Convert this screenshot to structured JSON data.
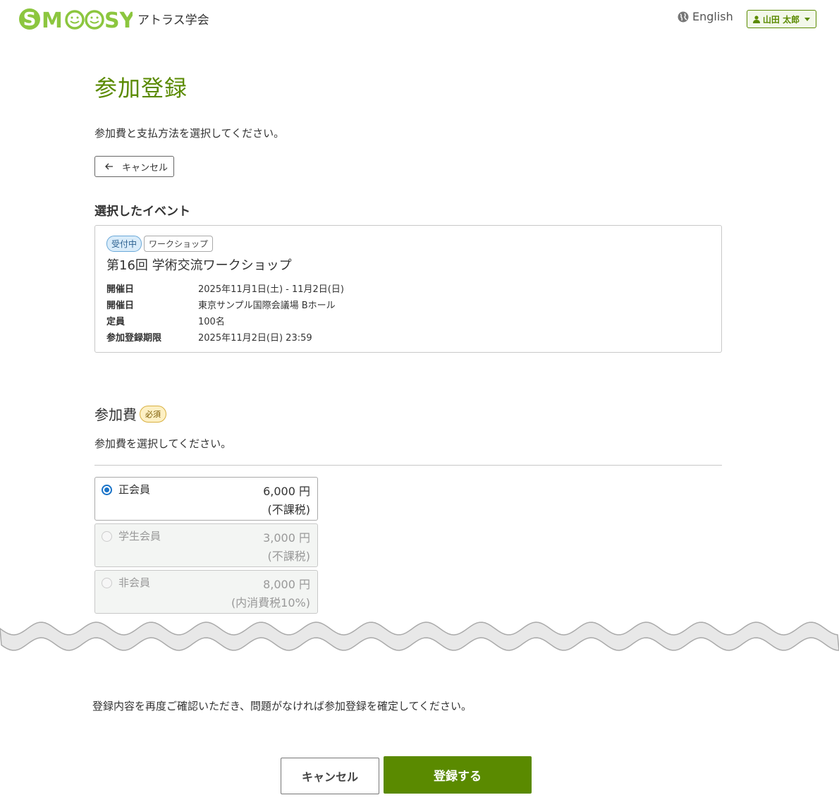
{
  "header": {
    "logo_text": "SMOOSY",
    "org_name": "アトラス学会",
    "language_link": "English",
    "user_name": "山田 太郎"
  },
  "page": {
    "title": "参加登録",
    "intro": "参加費と支払方法を選択してください。",
    "back_button": "キャンセル"
  },
  "event_section": {
    "heading": "選択したイベント",
    "status_badge": "受付中",
    "type_badge": "ワークショップ",
    "name": "第16回 学術交流ワークショップ",
    "details": [
      {
        "label": "開催日",
        "value": "2025年11月1日(土) - 11月2日(日)"
      },
      {
        "label": "開催日",
        "value": "東京サンプル国際会議場 Bホール"
      },
      {
        "label": "定員",
        "value": "100名"
      },
      {
        "label": "参加登録期限",
        "value": "2025年11月2日(日) 23:59"
      }
    ]
  },
  "fee_section": {
    "heading": "参加費",
    "required_badge": "必須",
    "description": "参加費を選択してください。",
    "options": [
      {
        "label": "正会員",
        "price": "6,000 円",
        "tax": "(不課税)",
        "selected": true,
        "disabled": false
      },
      {
        "label": "学生会員",
        "price": "3,000 円",
        "tax": "(不課税)",
        "selected": false,
        "disabled": true
      },
      {
        "label": "非会員",
        "price": "8,000 円",
        "tax": "(内消費税10%)",
        "selected": false,
        "disabled": true
      }
    ]
  },
  "footer": {
    "confirm_text": "登録内容を再度ご確認いただき、問題がなければ参加登録を確定してください。",
    "cancel_button": "キャンセル",
    "submit_button": "登録する"
  },
  "colors": {
    "brand_green": "#5a8a00",
    "logo_green": "#8cc63f",
    "radio_blue": "#1a73c8"
  }
}
